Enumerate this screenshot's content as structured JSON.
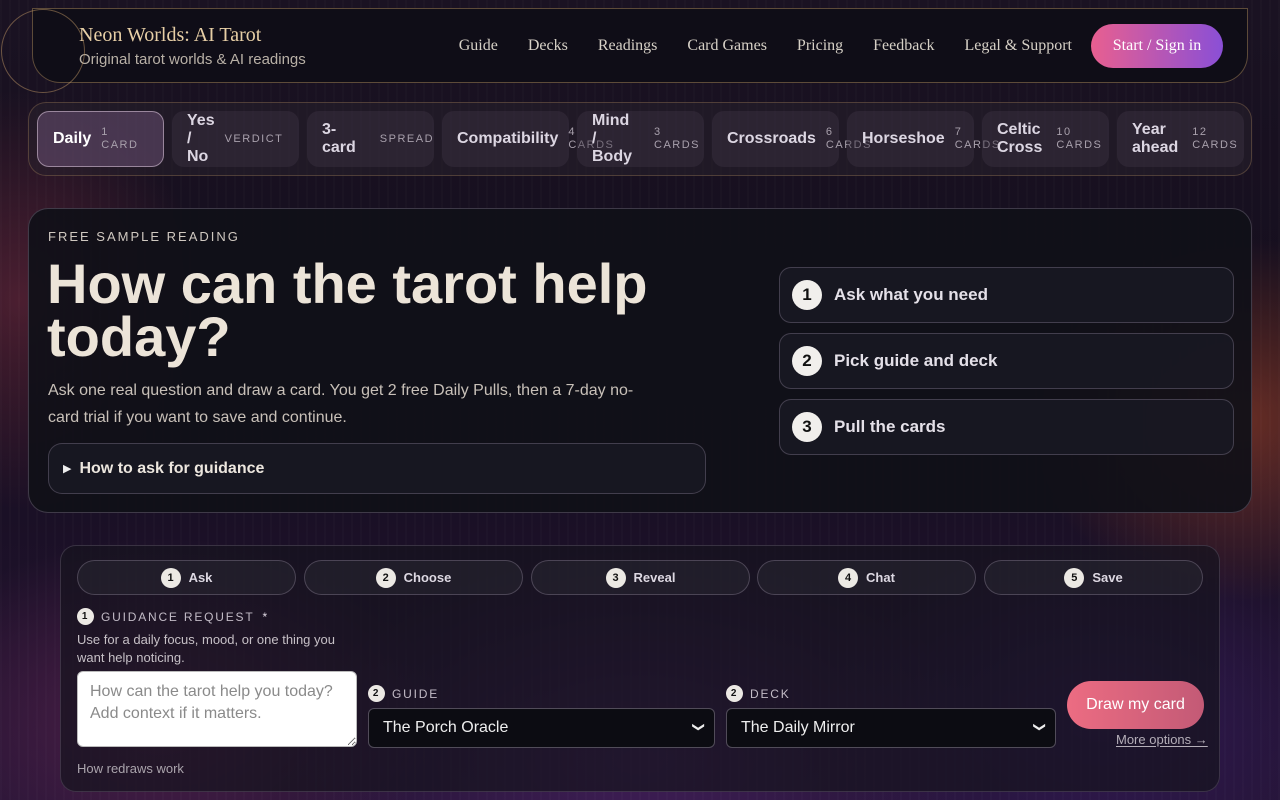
{
  "header": {
    "brand_title": "Neon Worlds: AI Tarot",
    "brand_subtitle": "Original tarot worlds & AI readings",
    "nav": [
      "Guide",
      "Decks",
      "Readings",
      "Card Games",
      "Pricing",
      "Feedback",
      "Legal & Support"
    ],
    "cta": "Start / Sign in"
  },
  "spreads": [
    {
      "name": "Daily",
      "meta": "1\nCARD",
      "active": true
    },
    {
      "name": "Yes\n/\nNo",
      "meta": "VERDICT"
    },
    {
      "name": "3-\ncard",
      "meta": "SPREAD"
    },
    {
      "name": "Compatibility",
      "meta": "4\nCARDS"
    },
    {
      "name": "Mind\n/\nBody",
      "meta": "3\nCARDS"
    },
    {
      "name": "Crossroads",
      "meta": "6\nCARDS"
    },
    {
      "name": "Horseshoe",
      "meta": "7\nCARDS"
    },
    {
      "name": "Celtic\nCross",
      "meta": "10\nCARDS"
    },
    {
      "name": "Year\nahead",
      "meta": "12\nCARDS"
    }
  ],
  "hero": {
    "eyebrow": "FREE SAMPLE READING",
    "title": "How can the tarot help today?",
    "description": "Ask one real question and draw a card. You get 2 free Daily Pulls, then a 7-day no-card trial if you want to save and continue.",
    "howto": "How to ask for guidance",
    "steps": [
      {
        "num": "1",
        "label": "Ask what you need"
      },
      {
        "num": "2",
        "label": "Pick guide and deck"
      },
      {
        "num": "3",
        "label": "Pull the cards"
      }
    ]
  },
  "form": {
    "progress": [
      {
        "num": "1",
        "label": "Ask"
      },
      {
        "num": "2",
        "label": "Choose"
      },
      {
        "num": "3",
        "label": "Reveal"
      },
      {
        "num": "4",
        "label": "Chat"
      },
      {
        "num": "5",
        "label": "Save"
      }
    ],
    "request_num": "1",
    "request_label": "GUIDANCE REQUEST",
    "required_mark": "*",
    "request_hint": "Use for a daily focus, mood, or one thing you want help noticing.",
    "request_placeholder": "How can the tarot help you today? Add context if it matters.",
    "guide_num": "2",
    "guide_label": "GUIDE",
    "guide_value": "The Porch Oracle",
    "deck_num": "2",
    "deck_label": "DECK",
    "deck_value": "The Daily Mirror",
    "draw_button": "Draw my card",
    "more_options": "More options →",
    "redraws": "How redraws work"
  }
}
